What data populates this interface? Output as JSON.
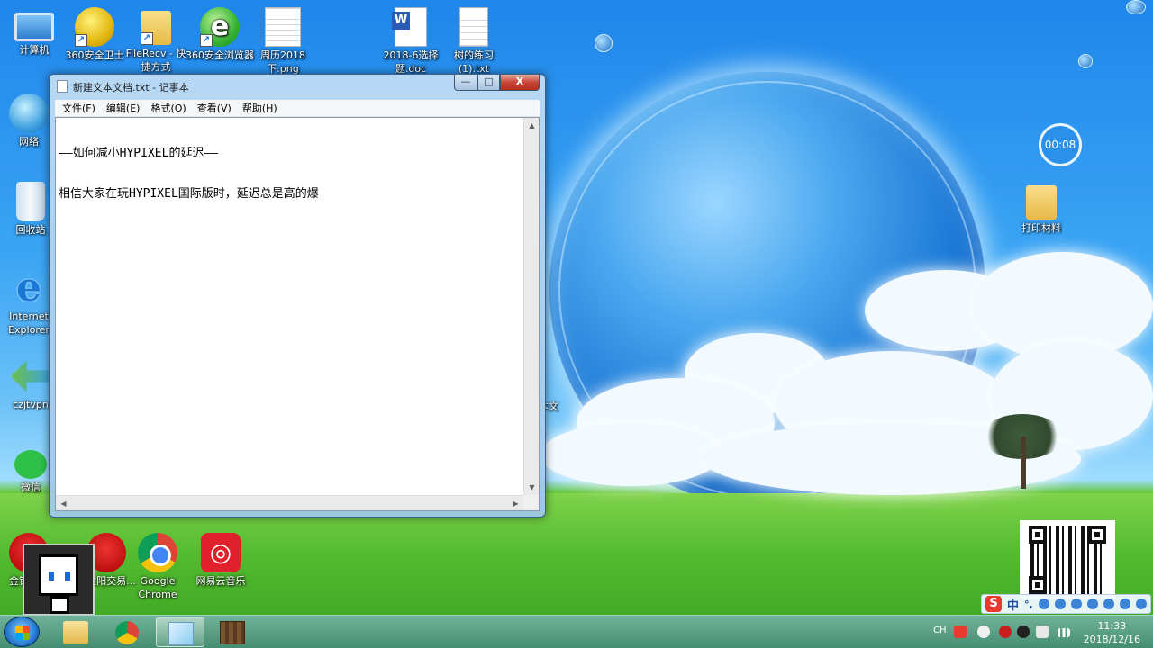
{
  "desktop_icons": {
    "computer": "计算机",
    "safe360": "360安全卫士",
    "filerecv": "FileRecv - 快捷方式",
    "browser360": "360安全浏览器",
    "calendar_png": "周历2018下.png",
    "doc_2018": "2018-6选择题.doc",
    "tree_txt": "树的练习 (1).txt",
    "network": "网络",
    "recycle": "回收站",
    "ie": "Internet Explorer",
    "vpn": "czjtvpn",
    "wechat": "微信",
    "stock": "金钱交易",
    "sun": "金太阳交易...",
    "chrome": "Google Chrome",
    "netease_music": "网易云音乐",
    "print_folder": "打印材料",
    "partial_text": "本文"
  },
  "timer": {
    "value": "00:08"
  },
  "notepad": {
    "title": "新建文本文档.txt - 记事本",
    "menu": [
      "文件(F)",
      "编辑(E)",
      "格式(O)",
      "查看(V)",
      "帮助(H)"
    ],
    "content_line1": "——如何减小HYPIXEL的延迟——",
    "content_line2": "相信大家在玩HYPIXEL国际版时，延迟总是高的爆",
    "btn_min": "—",
    "btn_max": "□",
    "btn_close": "X"
  },
  "tray": {
    "lang": "CH",
    "time": "11:33",
    "date": "2018/12/16"
  },
  "ime": {
    "s_label": "S",
    "mode": "中",
    "punct": "°,"
  }
}
